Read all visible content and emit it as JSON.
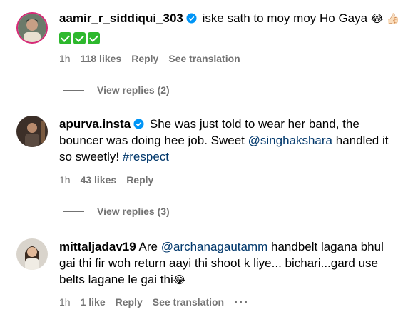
{
  "comments": [
    {
      "username": "aamir_r_siddiqui_303",
      "verified": true,
      "text": "iske sath to moy moy Ho Gaya",
      "emojis": "😂 👍🏻",
      "checks": 3,
      "time": "1h",
      "likes": "118 likes",
      "reply": "Reply",
      "translation": "See translation",
      "view_replies": "View replies (2)"
    },
    {
      "username": "apurva.insta",
      "verified": true,
      "text_1": "She was just told to wear her band, the bouncer was doing hee job. Sweet ",
      "mention": "@singhakshara",
      "text_2": " handled it so sweetly! ",
      "hashtag": "#respect",
      "time": "1h",
      "likes": "43 likes",
      "reply": "Reply",
      "view_replies": "View replies (3)"
    },
    {
      "username": "mittaljadav19",
      "verified": false,
      "text_1": "Are ",
      "mention": "@archanagautamm",
      "text_2": " handbelt lagana bhul gai thi fir woh return aayi thi shoot k liye... bichari...gard use belts lagane le gai thi",
      "emoji": "😂",
      "time": "1h",
      "likes": "1 like",
      "reply": "Reply",
      "translation": "See translation",
      "more": "···"
    }
  ],
  "colors": {
    "link": "#00376b",
    "meta": "#737373",
    "verified": "#0095f6",
    "check": "#2db82d"
  }
}
